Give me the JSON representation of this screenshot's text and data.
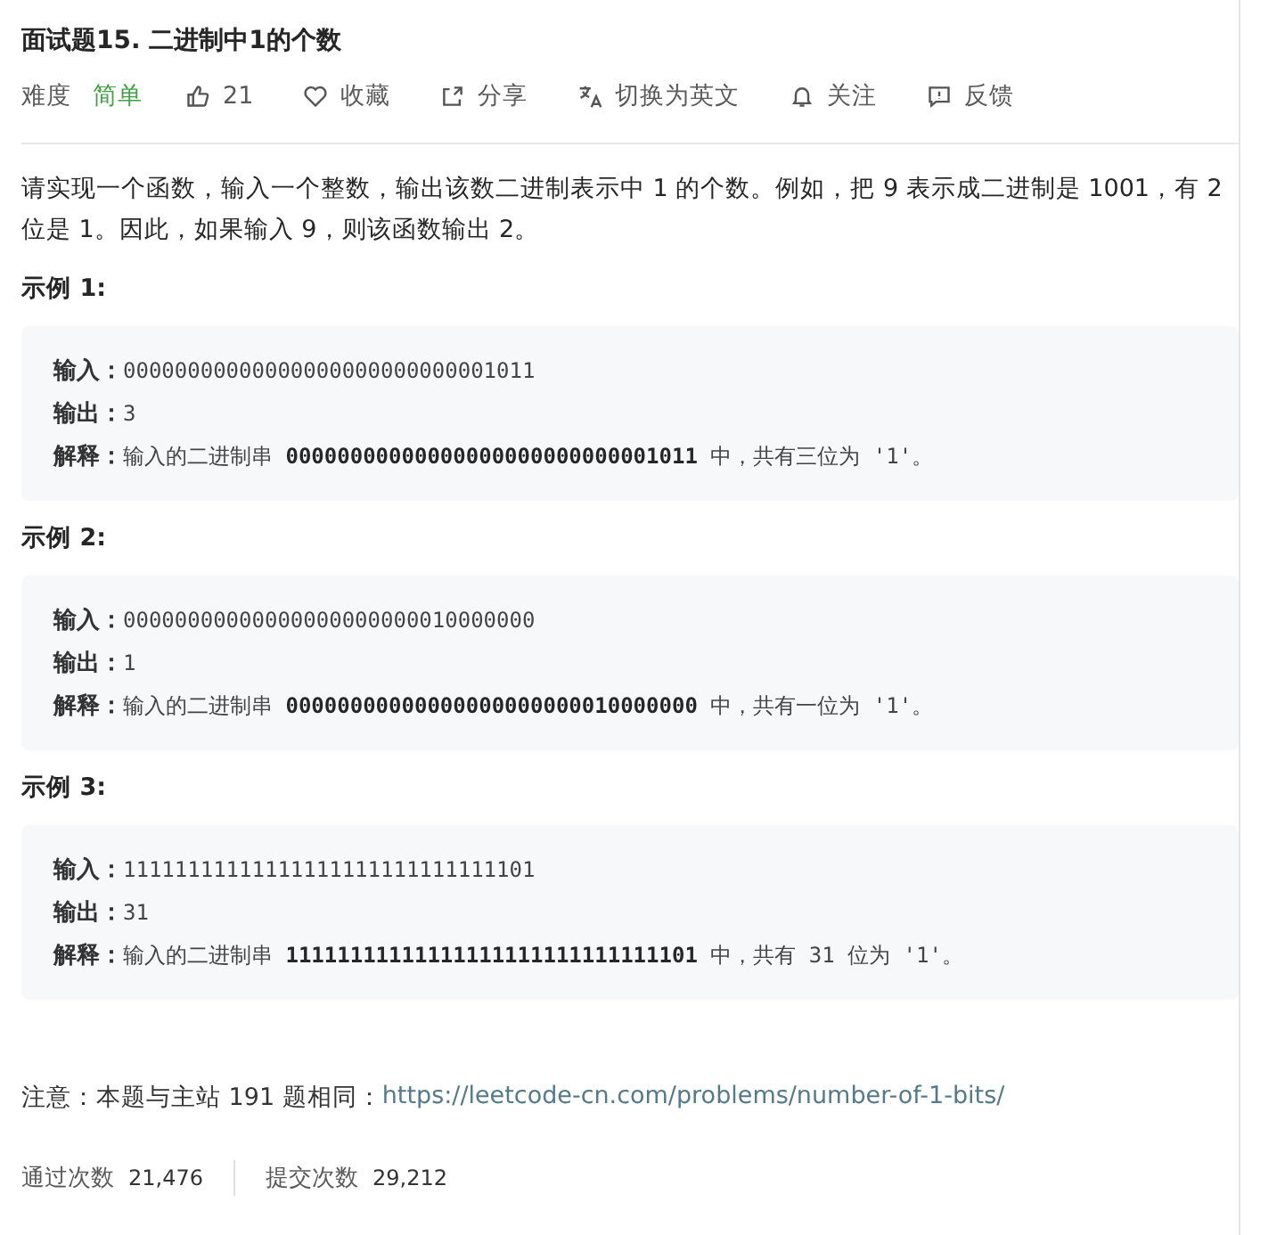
{
  "title": "面试题15. 二进制中1的个数",
  "toolbar": {
    "difficulty_label": "难度",
    "difficulty": "简单",
    "actions": [
      {
        "kind": "like",
        "label": "21"
      },
      {
        "kind": "favorite",
        "label": "收藏"
      },
      {
        "kind": "share",
        "label": "分享"
      },
      {
        "kind": "translate",
        "label": "切换为英文"
      },
      {
        "kind": "follow",
        "label": "关注"
      },
      {
        "kind": "feedback",
        "label": "反馈"
      }
    ]
  },
  "description": "请实现一个函数，输入一个整数，输出该数二进制表示中 1 的个数。例如，把 9 表示成二进制是 1001，有 2 位是 1。因此，如果输入 9，则该函数输出 2。",
  "examples": [
    {
      "heading": "示例 1:",
      "lines": [
        {
          "label": "输入：",
          "text": "00000000000000000000000000001011"
        },
        {
          "label": "输出：",
          "text": "3"
        },
        {
          "label": "解释：",
          "text": "输入的二进制串 **00000000000000000000000000001011** 中，共有三位为 '1'。"
        }
      ]
    },
    {
      "heading": "示例 2:",
      "lines": [
        {
          "label": "输入：",
          "text": "00000000000000000000000010000000"
        },
        {
          "label": "输出：",
          "text": "1"
        },
        {
          "label": "解释：",
          "text": "输入的二进制串 **00000000000000000000000010000000** 中，共有一位为 '1'。"
        }
      ]
    },
    {
      "heading": "示例 3:",
      "lines": [
        {
          "label": "输入：",
          "text": "11111111111111111111111111111101"
        },
        {
          "label": "输出：",
          "text": "31"
        },
        {
          "label": "解释：",
          "text": "输入的二进制串 **11111111111111111111111111111101** 中，共有 31 位为 '1'。"
        }
      ]
    }
  ],
  "note": {
    "text": "注意：本题与主站 191 题相同：",
    "link": "https://leetcode-cn.com/problems/number-of-1-bits/"
  },
  "stats": [
    {
      "label": "通过次数",
      "value": "21,476"
    },
    {
      "label": "提交次数",
      "value": "29,212"
    }
  ]
}
